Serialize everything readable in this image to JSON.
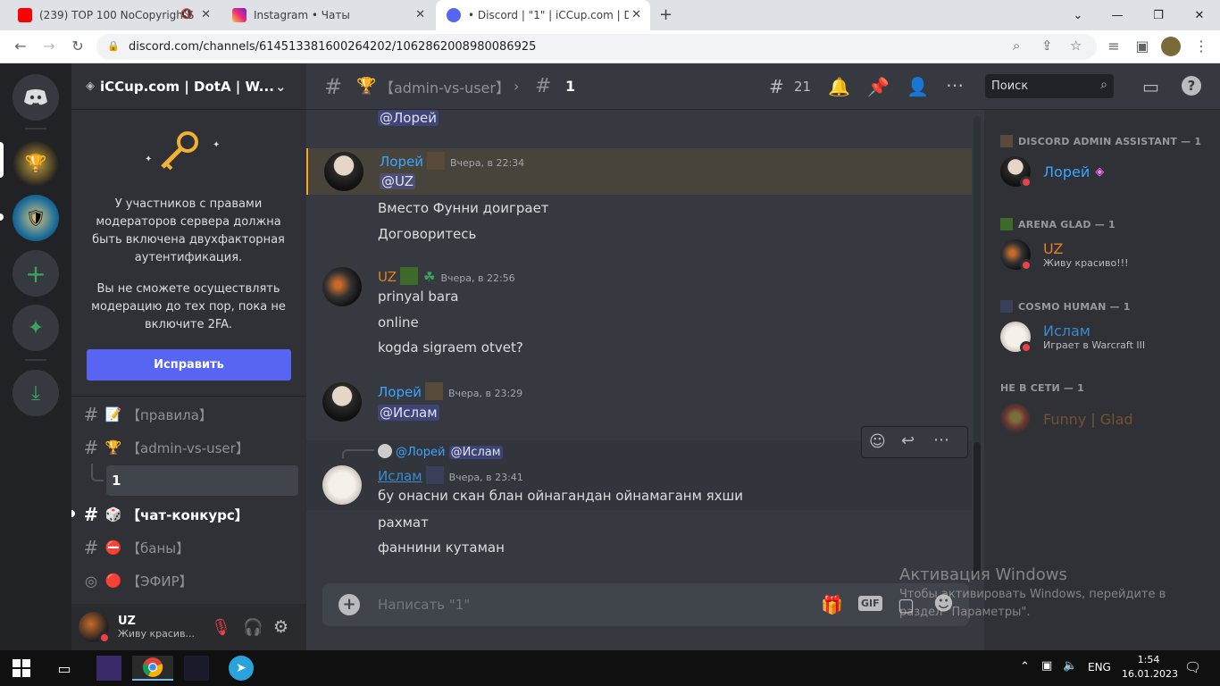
{
  "browser": {
    "tabs": [
      {
        "title": "(239) TOP 100 NoCopyrightS",
        "color": "#ff0000"
      },
      {
        "title": "Instagram • Чаты",
        "color": "#d6249f"
      },
      {
        "title": "• Discord | \"1\" | iCCup.com | DotA",
        "color": "#5865f2"
      }
    ],
    "url": "discord.com/channels/614513381600264202/1062862008980086925"
  },
  "server": {
    "name": "iCCup.com | DotA | W...",
    "twofa_notice": "У участников с правами модераторов сервера должна быть включена двухфакторная аутентификация.",
    "twofa_notice2": "Вы не сможете осуществлять модерацию до тех пор, пока не включите 2FA.",
    "fix_button": "Исправить",
    "channels": [
      {
        "name": "【правила】",
        "emoji": "📝",
        "type": "#"
      },
      {
        "name": "【admin-vs-user】",
        "emoji": "🏆",
        "type": "#"
      },
      {
        "name": "1",
        "emoji": "",
        "type": "thread"
      },
      {
        "name": "【чат-конкурс】",
        "emoji": "🎲",
        "type": "#"
      },
      {
        "name": "【баны】",
        "emoji": "⛔",
        "type": "#"
      },
      {
        "name": "【ЭФИР】",
        "emoji": "🔴",
        "type": "stage"
      }
    ]
  },
  "user": {
    "name": "UZ",
    "status": "Живу красив..."
  },
  "header": {
    "channel": "【admin-vs-user】",
    "thread": "1",
    "threads_count": "21",
    "search_placeholder": "Поиск"
  },
  "messages": {
    "top_mention": "@Лорей",
    "m1": {
      "author": "Лорей",
      "time": "Вчера, в 22:34",
      "mention": "@UZ",
      "lines": [
        "Вместо Фунни доиграет",
        "Договоритесь"
      ]
    },
    "m2": {
      "author": "UZ",
      "time": "Вчера, в 22:56",
      "lines": [
        "prinyal bara",
        "online",
        "kogda sigraem otvet?"
      ]
    },
    "m3": {
      "author": "Лорей",
      "time": "Вчера, в 23:29",
      "mention": "@Ислам"
    },
    "m4": {
      "reply_author": "@Лорей",
      "reply_mention": "@Ислам",
      "author": "Ислам",
      "time": "Вчера, в 23:41",
      "lines": [
        "бу онасни скан блан ойнагандан ойнамаганм яхши",
        "рахмат",
        "фаннини кутаман"
      ]
    }
  },
  "composer": {
    "placeholder": "Написать \"1\""
  },
  "members": {
    "groups": [
      {
        "title": "DISCORD ADMIN ASSISTANT — 1",
        "name": "Лорей",
        "activity": "",
        "color": "#3ba5ff"
      },
      {
        "title": "ARENA GLAD — 1",
        "name": "UZ",
        "activity": "Живу красиво!!!",
        "color": "#e67e22"
      },
      {
        "title": "COSMO HUMAN — 1",
        "name": "Ислам",
        "activity": "Играет в Warcraft III",
        "color": "#3b8bcf"
      },
      {
        "title": "НЕ В СЕТИ — 1",
        "name": "Funny | Glad",
        "activity": "",
        "color": "#a0522d"
      }
    ]
  },
  "watermark": {
    "title": "Активация Windows",
    "text": "Чтобы активировать Windows, перейдите в раздел \"Параметры\"."
  },
  "taskbar": {
    "time": "1:54",
    "date": "16.01.2023",
    "lang": "ENG"
  }
}
